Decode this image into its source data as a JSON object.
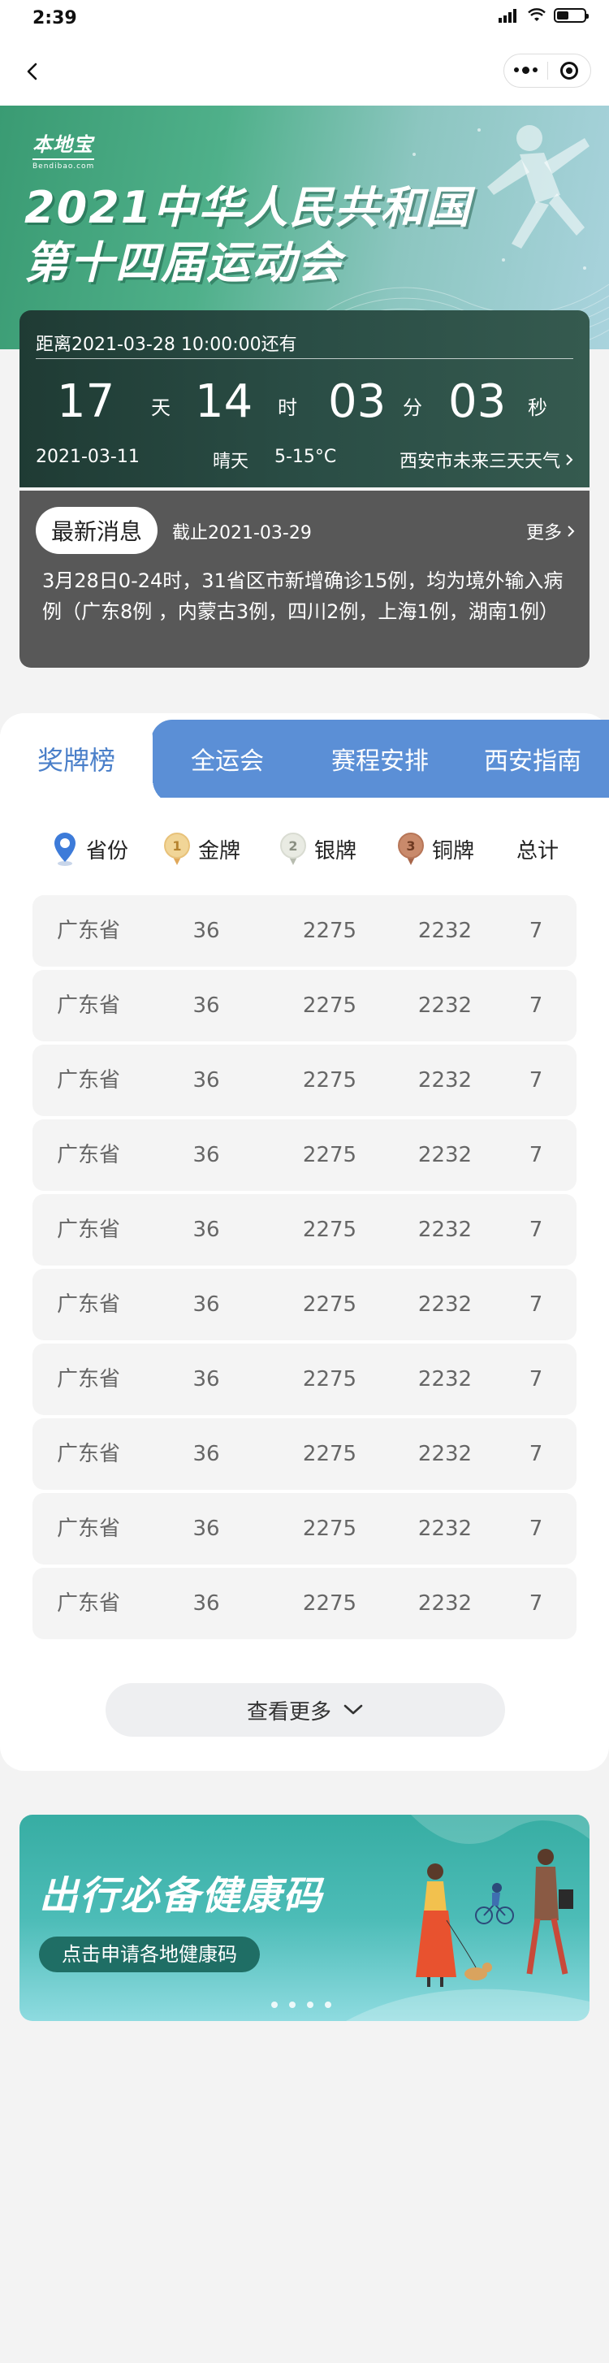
{
  "status": {
    "time": "2:39"
  },
  "banner": {
    "logo_cn": "本地宝",
    "logo_en": "Bendibao.com",
    "title_line1": "2021中华人民共和国",
    "title_line2": "第十四届运动会"
  },
  "countdown": {
    "header": "距离2021-03-28 10:00:00还有",
    "days": "17",
    "days_unit": "天",
    "hours": "14",
    "hours_unit": "时",
    "minutes": "03",
    "minutes_unit": "分",
    "seconds": "03",
    "seconds_unit": "秒",
    "date": "2021-03-11",
    "weather": "晴天",
    "temperature": "5-15°C",
    "weather_link": "西安市未来三天天气"
  },
  "news": {
    "tag": "最新消息",
    "date": "截止2021-03-29",
    "more": "更多",
    "body": "3月28日0-24时，31省区市新增确诊15例，均为境外输入病例（广东8例 ，内蒙古3例，四川2例，上海1例，湖南1例）"
  },
  "tabs": [
    {
      "label": "奖牌榜"
    },
    {
      "label": "全运会"
    },
    {
      "label": "赛程安排"
    },
    {
      "label": "西安指南"
    }
  ],
  "medal_header": {
    "province": "省份",
    "gold": "金牌",
    "silver": "银牌",
    "bronze": "铜牌",
    "total": "总计",
    "gold_rank": "1",
    "silver_rank": "2",
    "bronze_rank": "3"
  },
  "medal_rows": [
    {
      "province": "广东省",
      "gold": "36",
      "silver": "2275",
      "bronze": "2232",
      "total": "7"
    },
    {
      "province": "广东省",
      "gold": "36",
      "silver": "2275",
      "bronze": "2232",
      "total": "7"
    },
    {
      "province": "广东省",
      "gold": "36",
      "silver": "2275",
      "bronze": "2232",
      "total": "7"
    },
    {
      "province": "广东省",
      "gold": "36",
      "silver": "2275",
      "bronze": "2232",
      "total": "7"
    },
    {
      "province": "广东省",
      "gold": "36",
      "silver": "2275",
      "bronze": "2232",
      "total": "7"
    },
    {
      "province": "广东省",
      "gold": "36",
      "silver": "2275",
      "bronze": "2232",
      "total": "7"
    },
    {
      "province": "广东省",
      "gold": "36",
      "silver": "2275",
      "bronze": "2232",
      "total": "7"
    },
    {
      "province": "广东省",
      "gold": "36",
      "silver": "2275",
      "bronze": "2232",
      "total": "7"
    },
    {
      "province": "广东省",
      "gold": "36",
      "silver": "2275",
      "bronze": "2232",
      "total": "7"
    },
    {
      "province": "广东省",
      "gold": "36",
      "silver": "2275",
      "bronze": "2232",
      "total": "7"
    }
  ],
  "more_button": "查看更多",
  "health_banner": {
    "title": "出行必备健康码",
    "button": "点击申请各地健康码"
  },
  "colors": {
    "tab_blue": "#5b8fd6",
    "tab_active_text": "#4a7fc9",
    "countdown_bg": "#2a4d45",
    "news_bg": "#585858",
    "gold": "#e8c27a",
    "silver": "#d9dcd2",
    "bronze": "#c98a6b"
  },
  "icons": [
    "back-arrow-icon",
    "more-dots-icon",
    "target-icon",
    "location-pin-icon",
    "gold-medal-icon",
    "silver-medal-icon",
    "bronze-medal-icon",
    "chevron-right-icon",
    "chevron-down-icon"
  ]
}
